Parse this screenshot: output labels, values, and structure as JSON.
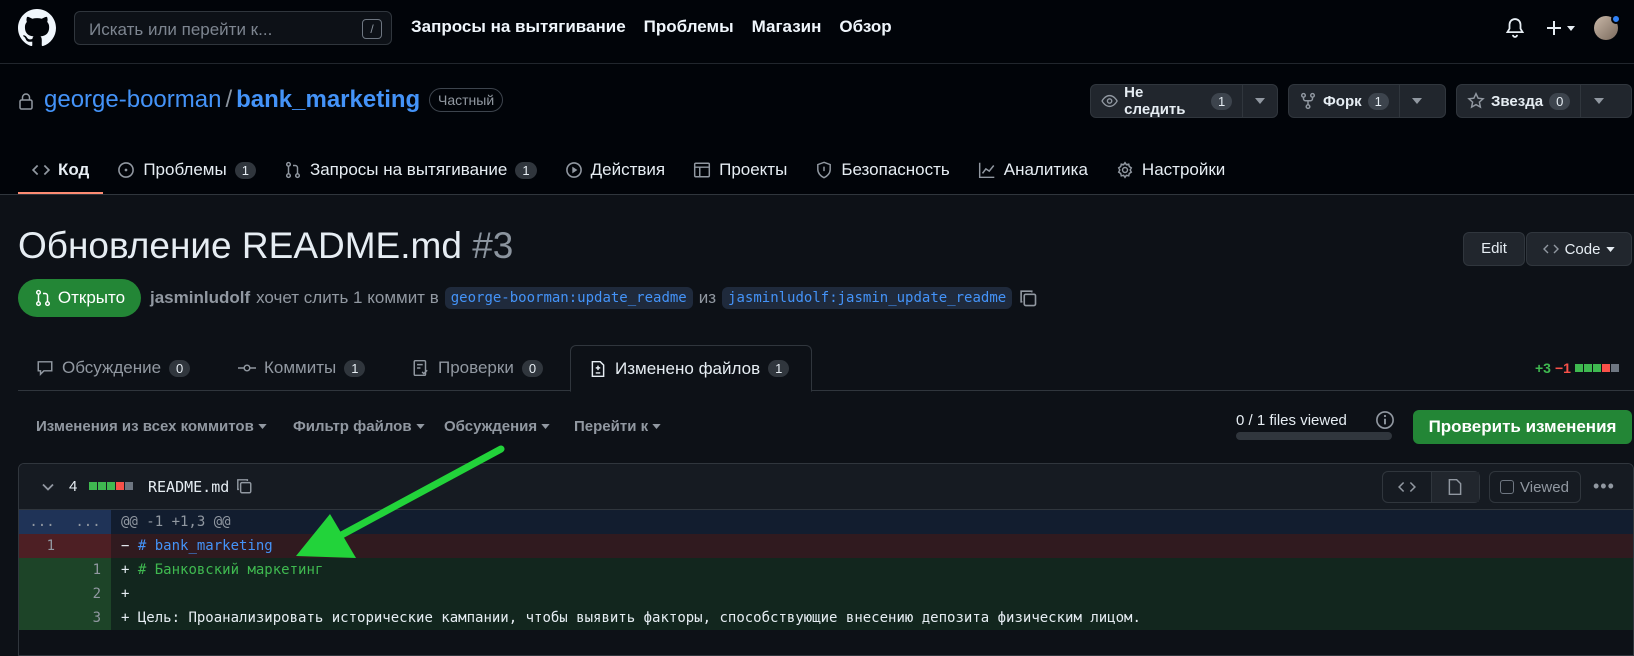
{
  "header": {
    "search_placeholder": "Искать или перейти к...",
    "search_key": "/",
    "nav": [
      "Запросы на вытягивание",
      "Проблемы",
      "Магазин",
      "Обзор"
    ]
  },
  "repo": {
    "owner": "george-boorman",
    "separator": "/",
    "name": "bank_marketing",
    "visibility": "Частный",
    "watch": {
      "label": "Не следить",
      "count": "1"
    },
    "fork": {
      "label": "Форк",
      "count": "1"
    },
    "star": {
      "label": "Звезда",
      "count": "0"
    },
    "tabs": [
      {
        "label": "Код",
        "count": null,
        "icon": "code-icon"
      },
      {
        "label": "Проблемы",
        "count": "1",
        "icon": "issue-icon"
      },
      {
        "label": "Запросы на вытягивание",
        "count": "1",
        "icon": "pull-request-icon"
      },
      {
        "label": "Действия",
        "count": null,
        "icon": "play-icon"
      },
      {
        "label": "Проекты",
        "count": null,
        "icon": "table-icon"
      },
      {
        "label": "Безопасность",
        "count": null,
        "icon": "shield-icon"
      },
      {
        "label": "Аналитика",
        "count": null,
        "icon": "graph-icon"
      },
      {
        "label": "Настройки",
        "count": null,
        "icon": "gear-icon"
      }
    ]
  },
  "pr": {
    "title": "Обновление README.md",
    "number": "#3",
    "edit_label": "Edit",
    "code_label": "Code",
    "state": "Открыто",
    "author": "jasminludolf",
    "merge_text": "хочет слить 1 коммит в",
    "base_branch": "george-boorman:update_readme",
    "from_text": "из",
    "head_branch": "jasminludolf:jasmin_update_readme",
    "tabs": [
      {
        "label": "Обсуждение",
        "count": "0",
        "icon": "comment-icon"
      },
      {
        "label": "Коммиты",
        "count": "1",
        "icon": "commit-icon"
      },
      {
        "label": "Проверки",
        "count": "0",
        "icon": "checklist-icon"
      },
      {
        "label": "Изменено файлов",
        "count": "1",
        "icon": "file-diff-icon"
      }
    ],
    "additions": "+3",
    "deletions": "−1"
  },
  "toolbar": {
    "commits_filter": "Изменения из всех коммитов",
    "file_filter": "Фильтр файлов",
    "conversations": "Обсуждения",
    "jump_to": "Перейти к",
    "viewed_count": "0 / 1 files viewed",
    "review_button": "Проверить изменения"
  },
  "file": {
    "changes": "4",
    "name": "README.md",
    "viewed_label": "Viewed",
    "hunk_num": "...",
    "hunk_header": "@@ -1 +1,3 @@",
    "lines": [
      {
        "old": "1",
        "new": "",
        "marker": "−",
        "text": "# bank_marketing",
        "type": "del"
      },
      {
        "old": "",
        "new": "1",
        "marker": "+",
        "text": "# Банковский маркетинг",
        "type": "add"
      },
      {
        "old": "",
        "new": "2",
        "marker": "+",
        "text": "",
        "type": "add"
      },
      {
        "old": "",
        "new": "3",
        "marker": "+",
        "text": "Цель: Проанализировать исторические кампании, чтобы выявить факторы, способствующие внесению депозита физическим лицом.",
        "type": "add"
      }
    ]
  },
  "colors": {
    "accent": "#4493f8",
    "success": "#238636",
    "add": "#3fb950",
    "delete": "#f85149",
    "arrow": "#22d33a"
  }
}
